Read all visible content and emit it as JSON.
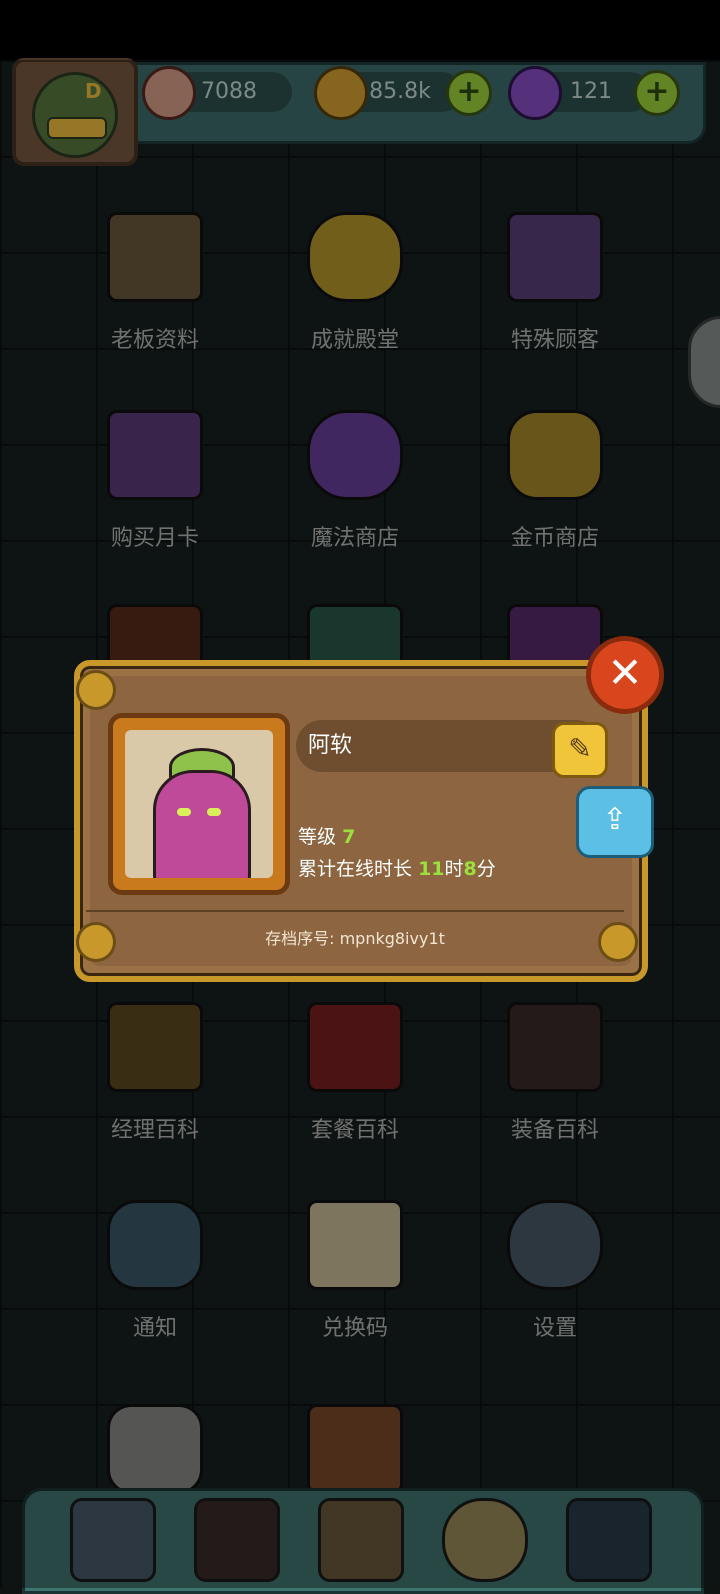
{
  "resources": {
    "eyes": "7088",
    "coins": "85.8k",
    "potions": "121"
  },
  "menu": [
    {
      "label": "老板资料",
      "icon": "id-card-icon"
    },
    {
      "label": "成就殿堂",
      "icon": "trophy-icon"
    },
    {
      "label": "特殊顾客",
      "icon": "customer-book-icon"
    },
    {
      "label": "购买月卡",
      "icon": "month-card-icon"
    },
    {
      "label": "魔法商店",
      "icon": "potion-shop-icon"
    },
    {
      "label": "金币商店",
      "icon": "coin-shop-icon"
    },
    {
      "label": "经理百科",
      "icon": "manager-book-icon"
    },
    {
      "label": "套餐百科",
      "icon": "meal-book-icon"
    },
    {
      "label": "装备百科",
      "icon": "equipment-book-icon"
    },
    {
      "label": "通知",
      "icon": "megaphone-icon"
    },
    {
      "label": "兑换码",
      "icon": "scroll-icon"
    },
    {
      "label": "设置",
      "icon": "gear-icon"
    }
  ],
  "profile": {
    "name": "阿软",
    "level_label": "等级",
    "level": "7",
    "online_label": "累计在线时长",
    "hours": "11",
    "hours_unit": "时",
    "minutes": "8",
    "minutes_unit": "分",
    "save_id": "存档序号: mpnkg8ivy1t"
  },
  "colors": {
    "accent_green": "#9be03c",
    "close_red": "#d9461e",
    "frame_gold": "#c9982a"
  }
}
